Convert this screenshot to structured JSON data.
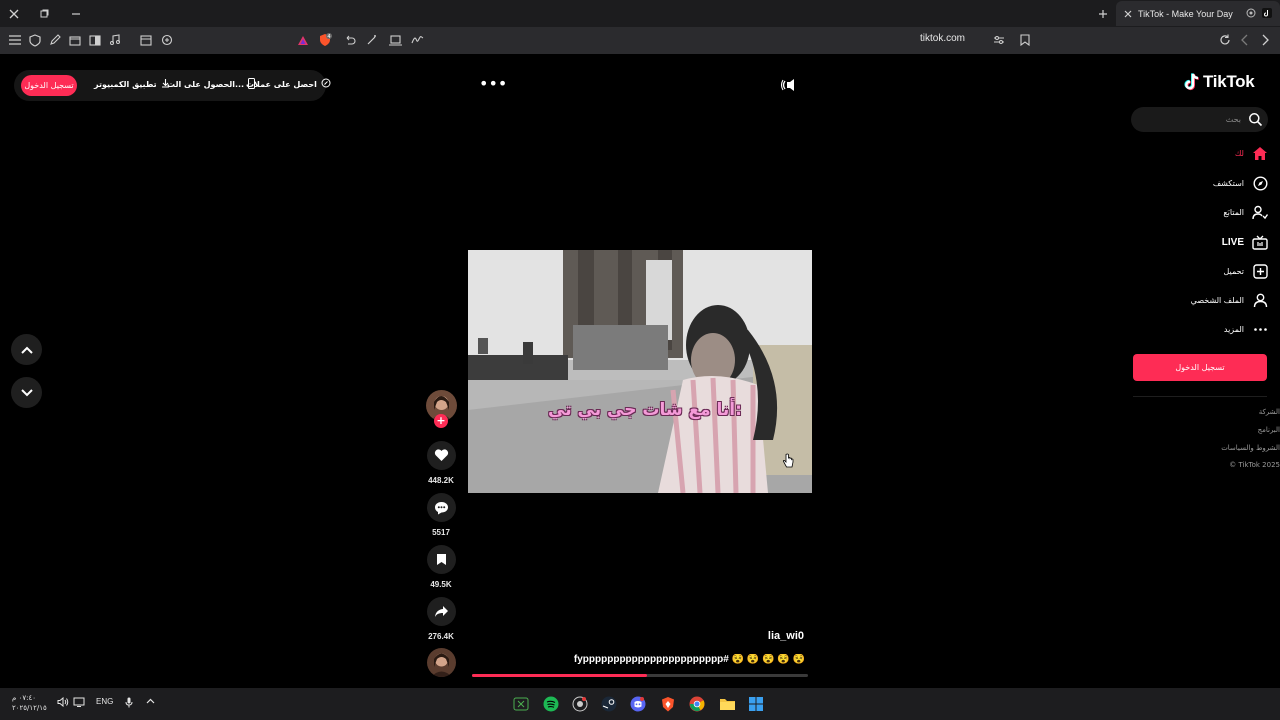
{
  "browser": {
    "tab_title": "TikTok - Make Your Day",
    "url": "tiktok.com",
    "shield_badge": "4"
  },
  "header": {
    "login_label": "تسجيل الدخول",
    "desktop_app_label": "تطبيق الكمبيوتر",
    "get_app_label": "الحصول على الت...",
    "coins_label": "احصل على عملات"
  },
  "video": {
    "overlay_caption": "أنا مع شات جي بي تي:",
    "likes": "448.2K",
    "comments": "5517",
    "saves": "49.5K",
    "shares": "276.4K",
    "username": "lia_wi0",
    "description": "fyppppppppppppppppppppppp# 😵 😵 😵 😵 😵",
    "progress": 0.52
  },
  "sidebar": {
    "logo_text": "TikTok",
    "search_placeholder": "بحث",
    "items": [
      {
        "label": "لك",
        "icon": "home-icon"
      },
      {
        "label": "استكشف",
        "icon": "compass-icon"
      },
      {
        "label": "المتابَع",
        "icon": "following-icon"
      },
      {
        "label": "LIVE",
        "icon": "live-tv-icon"
      },
      {
        "label": "تحميل",
        "icon": "upload-icon"
      },
      {
        "label": "الملف الشخصي",
        "icon": "profile-icon"
      },
      {
        "label": "المزيد",
        "icon": "more-icon"
      }
    ],
    "login_button": "تسجيل الدخول",
    "footer": [
      "الشركة",
      "البرنامج",
      "الشروط والسياسات",
      "© TikTok 2025"
    ]
  },
  "taskbar": {
    "time": "٠٧:٤٠ م",
    "date": "٢٠٢٥/١٢/١٥",
    "lang": "ENG"
  },
  "colors": {
    "accent": "#fe2c55",
    "background": "#000000",
    "panel": "#1f1f1f"
  }
}
